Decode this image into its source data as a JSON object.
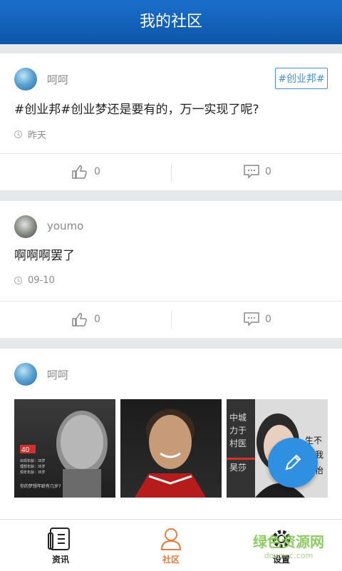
{
  "header": {
    "title": "我的社区"
  },
  "posts": [
    {
      "user": "呵呵",
      "tag": "#创业邦#",
      "content": "#创业邦#创业梦还是要有的，万一实现了呢?",
      "time": "昨天",
      "likes": "0",
      "comments": "0"
    },
    {
      "user": "youmo",
      "content": "啊啊啊罢了",
      "time": "09-10",
      "likes": "0",
      "comments": "0"
    },
    {
      "user": "呵呵",
      "images": [
        "man-portrait-photo",
        "woman-smiling-photo",
        "woman-poster-photo"
      ],
      "photo_texts": {
        "p1_big": "40",
        "p1_lines": [
          "出现年龄：35岁",
          "理想年龄：35岁",
          "现年年龄：35岁"
        ],
        "p1_footer": "你的梦想年龄有几岁?",
        "p3_lines": [
          "中城",
          "力于",
          "村医",
          "昊莎"
        ],
        "p3_right": [
          "生不",
          "我",
          "怡"
        ]
      }
    }
  ],
  "tabbar": {
    "items": [
      {
        "label": "资讯",
        "icon": "news-icon",
        "active": false
      },
      {
        "label": "社区",
        "icon": "community-icon",
        "active": true
      },
      {
        "label": "设置",
        "icon": "settings-gear-icon",
        "active": false
      }
    ]
  },
  "watermark": {
    "text": "绿色资源网",
    "sub": "downcc.com"
  },
  "colors": {
    "header": "#1565c0",
    "accent": "#4a90d9",
    "active_tab": "#e87c3e",
    "fab": "#2f8fe0"
  }
}
